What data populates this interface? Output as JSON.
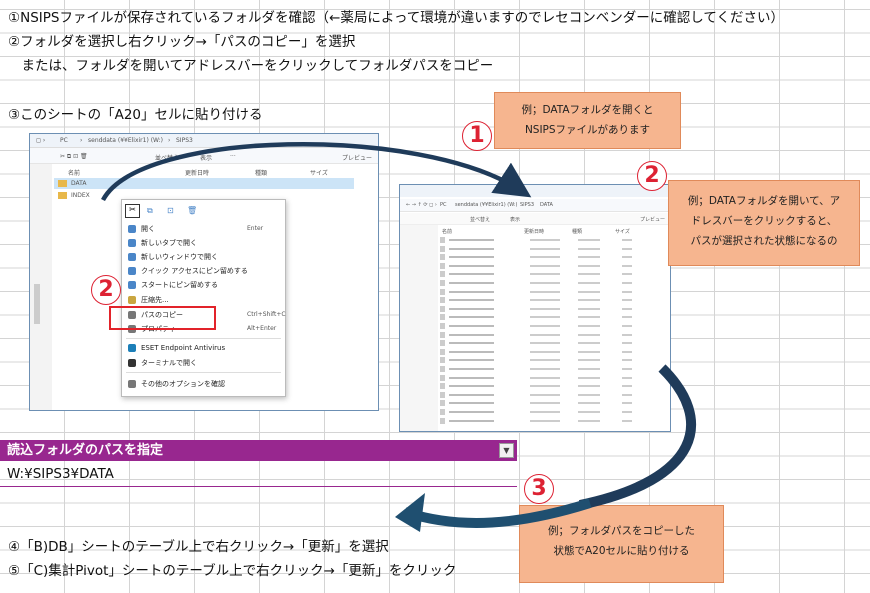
{
  "instructions": {
    "line1": "①NSIPSファイルが保存されているフォルダを確認（←薬局によって環境が違いますのでレセコンベンダーに確認してください）",
    "line2": "②フォルダを選択し右クリック→「パスのコピー」を選択",
    "line3": "　または、フォルダを開いてアドレスバーをクリックしてフォルダパスをコピー",
    "line4": "③このシートの「A20」セルに貼り付ける",
    "line5": "④「B)DB」シートのテーブル上で右クリック→「更新」を選択",
    "line6": "⑤「C)集計Pivot」シートのテーブル上で右クリック→「更新」をクリック"
  },
  "explorer_left": {
    "breadcrumb": [
      "PC",
      "senddata (¥¥Elixir1) (W:)",
      "SIPS3"
    ],
    "sort_label": "並べ替え",
    "view_label": "表示",
    "preview_label": "プレビュー",
    "columns": [
      "名前",
      "更新日時",
      "種類",
      "サイズ"
    ],
    "folders": [
      "DATA",
      "INDEX"
    ]
  },
  "context_menu": {
    "items": [
      {
        "label": "開く",
        "shortcut": "Enter"
      },
      {
        "label": "新しいタブで開く",
        "shortcut": ""
      },
      {
        "label": "新しいウィンドウで開く",
        "shortcut": ""
      },
      {
        "label": "クイック アクセスにピン留めする",
        "shortcut": ""
      },
      {
        "label": "スタートにピン留めする",
        "shortcut": ""
      },
      {
        "label": "圧縮先...",
        "shortcut": ""
      },
      {
        "label": "パスのコピー",
        "shortcut": "Ctrl+Shift+C"
      },
      {
        "label": "プロパティ",
        "shortcut": "Alt+Enter"
      },
      {
        "label": "ESET Endpoint Antivirus",
        "shortcut": ""
      },
      {
        "label": "ターミナルで開く",
        "shortcut": ""
      },
      {
        "label": "その他のオプションを確認",
        "shortcut": ""
      }
    ]
  },
  "explorer_right": {
    "breadcrumb": [
      "PC",
      "senddata (¥¥Elixir1) (W:)",
      "SIPS3",
      "DATA"
    ],
    "sort_label": "並べ替え",
    "view_label": "表示",
    "preview_label": "プレビュー",
    "columns": [
      "名前",
      "更新日時",
      "種類",
      "サイズ"
    ]
  },
  "callouts": {
    "c1_line1": "例；DATAフォルダを開くと",
    "c1_line2": "NSIPSファイルがあります",
    "c2_line1": "例；DATAフォルダを開いて、ア",
    "c2_line2": "ドレスバーをクリックすると、",
    "c2_line3": "パスが選択された状態になるの",
    "c3_line1": "例；フォルダパスをコピーした",
    "c3_line2": "状態でA20セルに貼り付ける"
  },
  "markers": {
    "m1": "1",
    "m2a": "2",
    "m2b": "2",
    "m3": "3"
  },
  "table": {
    "header": "読込フォルダのパスを指定",
    "value": "W:¥SIPS3¥DATA"
  },
  "colors": {
    "header_bg": "#98278f",
    "callout_bg": "#f6b58f",
    "arrow": "#1f3b5a",
    "marker": "#dd2233"
  }
}
